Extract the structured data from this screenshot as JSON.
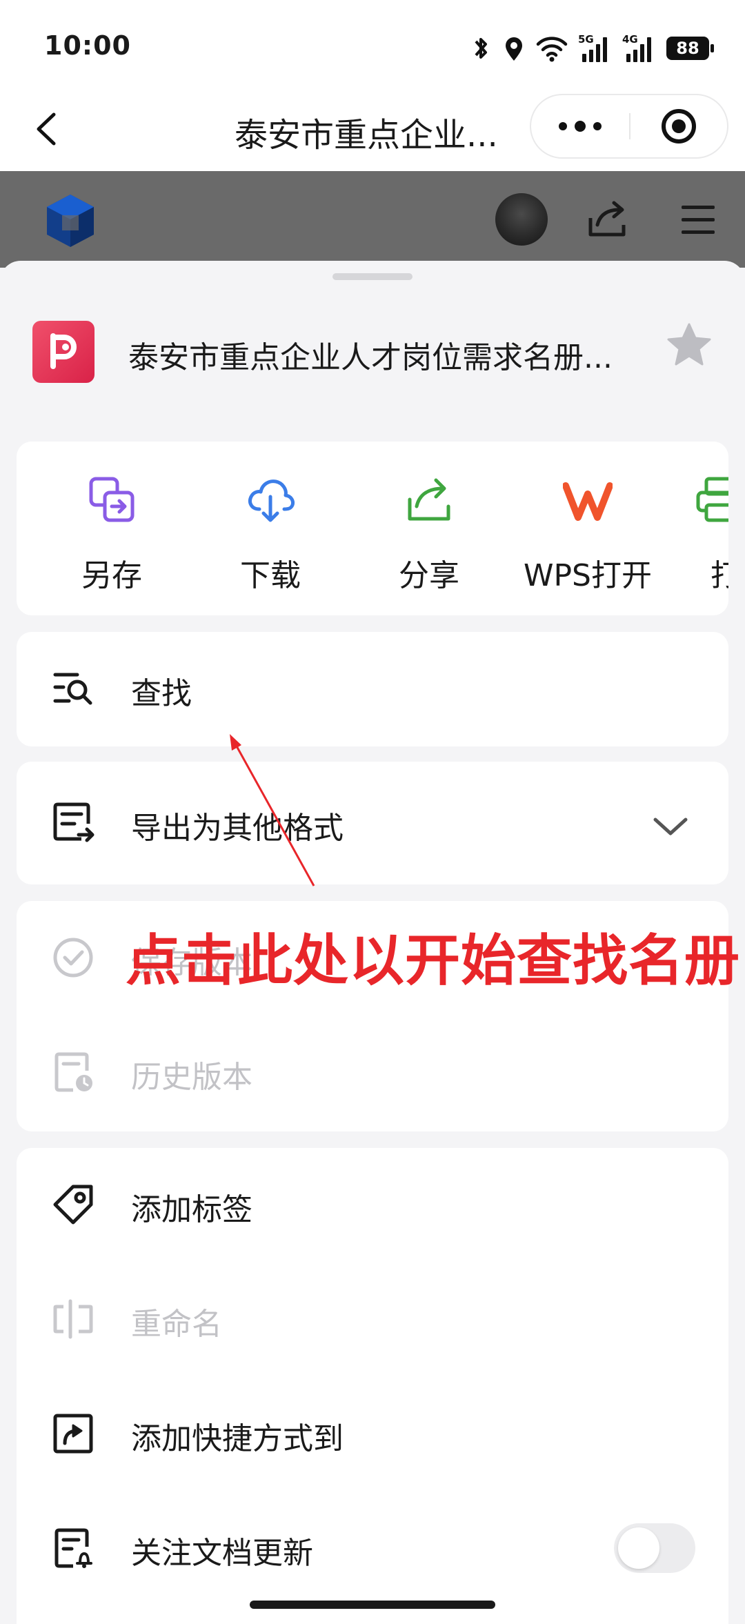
{
  "status_bar": {
    "time": "10:00",
    "battery": "88",
    "icons": [
      "bluetooth-icon",
      "location-icon",
      "wifi-icon",
      "5g-signal-icon",
      "4g-signal-icon",
      "battery-icon"
    ]
  },
  "nav": {
    "title": "泰安市重点企业..."
  },
  "sheet": {
    "doc_title": "泰安市重点企业人才岗位需求名册...",
    "actions": [
      {
        "label": "另存",
        "icon": "save-as-icon",
        "color": "#8a5ce6"
      },
      {
        "label": "下载",
        "icon": "cloud-download-icon",
        "color": "#3b7de8"
      },
      {
        "label": "分享",
        "icon": "share-icon",
        "color": "#3fa63f"
      },
      {
        "label": "WPS打开",
        "icon": "wps-icon",
        "color": "#f0542c"
      },
      {
        "label": "打",
        "icon": "print-icon",
        "color": "#3fa63f"
      }
    ],
    "find": {
      "label": "查找"
    },
    "export": {
      "label": "导出为其他格式"
    },
    "version": {
      "save_version_label": "保存版本",
      "history_label": "历史版本"
    },
    "more": {
      "add_tag": "添加标签",
      "rename": "重命名",
      "add_shortcut": "添加快捷方式到",
      "follow_updates": "关注文档更新"
    }
  },
  "annotation": {
    "text": "点击此处以开始查找名册",
    "color": "#e8262a"
  }
}
